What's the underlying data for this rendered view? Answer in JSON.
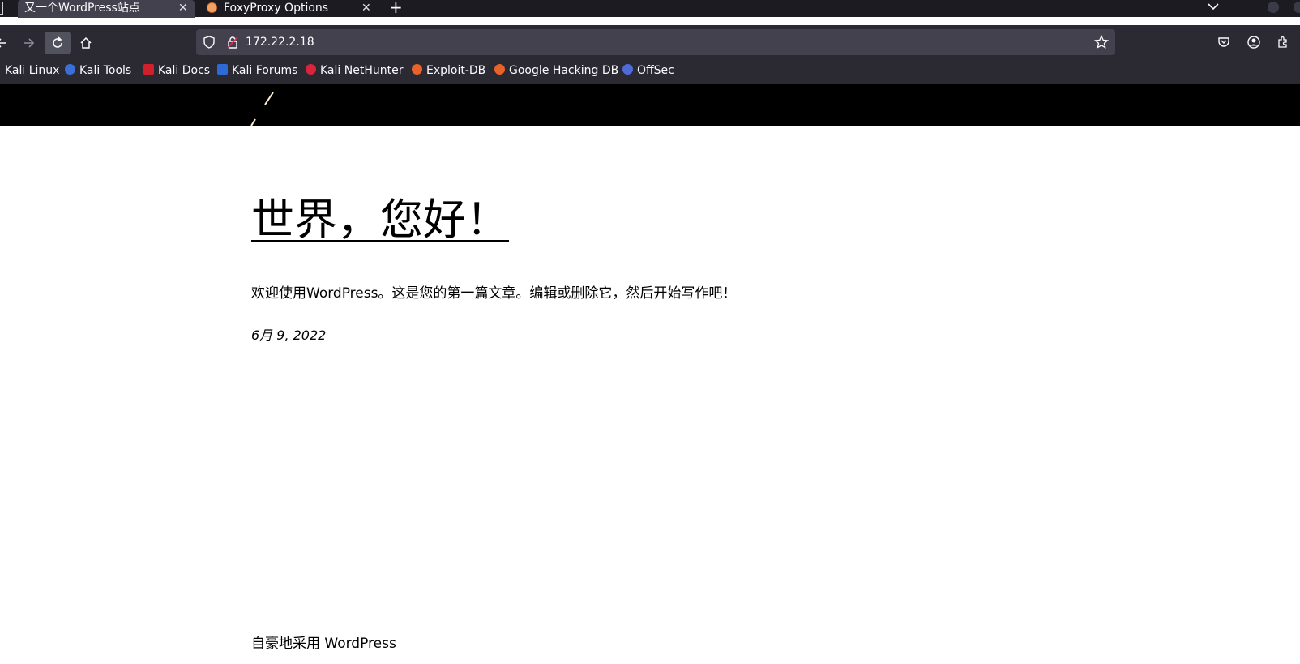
{
  "browser": {
    "tabs": [
      {
        "label": "又一个WordPress站点",
        "active": true
      },
      {
        "label": "FoxyProxy Options",
        "active": false
      }
    ],
    "url": "172.22.2.18",
    "bookmarks": [
      {
        "label": "Kali Linux",
        "icon": "kali-dragon-icon",
        "color": "#367bf0"
      },
      {
        "label": "Kali Tools",
        "icon": "kali-tools-icon",
        "color": "#3a6fd8"
      },
      {
        "label": "Kali Docs",
        "icon": "kali-docs-icon",
        "color": "#d0202b"
      },
      {
        "label": "Kali Forums",
        "icon": "kali-forums-icon",
        "color": "#2d6ad6"
      },
      {
        "label": "Kali NetHunter",
        "icon": "kali-nethunter-icon",
        "color": "#d7253c"
      },
      {
        "label": "Exploit-DB",
        "icon": "exploit-db-icon",
        "color": "#e8622a"
      },
      {
        "label": "Google Hacking DB",
        "icon": "ghdb-icon",
        "color": "#e8622a"
      },
      {
        "label": "OffSec",
        "icon": "offsec-icon",
        "color": "#4f6bd8"
      }
    ]
  },
  "post": {
    "title": "世界，您好！",
    "body": "欢迎使用WordPress。这是您的第一篇文章。编辑或删除它，然后开始写作吧！",
    "date": "6月 9, 2022"
  },
  "footer": {
    "text": "自豪地采用 ",
    "link": "WordPress"
  }
}
